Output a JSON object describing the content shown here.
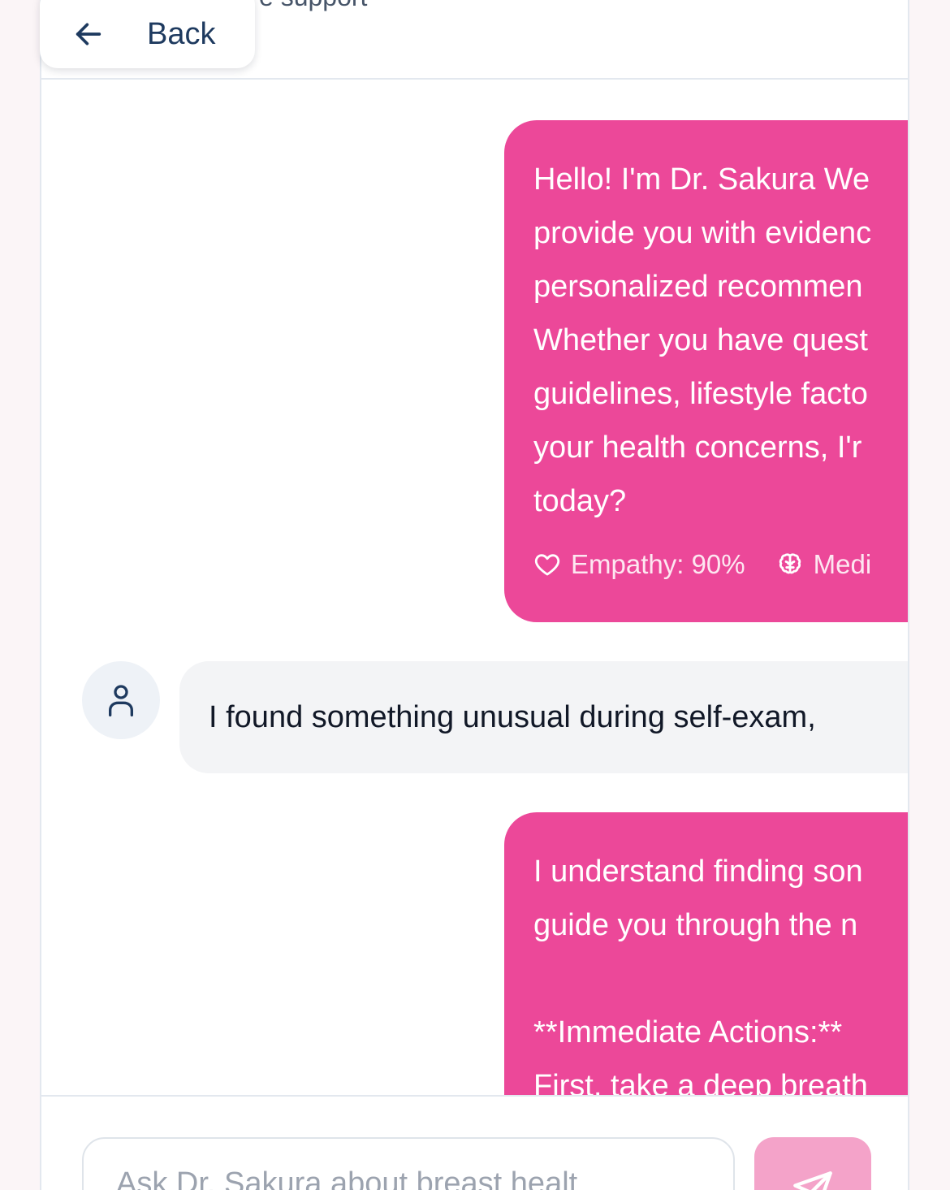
{
  "header": {
    "back_label": "Back",
    "subtitle": "e support"
  },
  "messages": [
    {
      "role": "assistant",
      "lines": [
        "Hello! I'm Dr. Sakura We",
        "provide you with evidenc",
        "personalized recommen",
        "Whether you have quest",
        "guidelines, lifestyle facto",
        "your health concerns, I'r",
        "today?"
      ],
      "metrics": [
        {
          "icon": "heart-icon",
          "label": "Empathy: 90%"
        },
        {
          "icon": "brain-icon",
          "label": "Medi"
        }
      ]
    },
    {
      "role": "user",
      "text": "I found something unusual during self-exam,"
    },
    {
      "role": "assistant",
      "lines": [
        "I understand finding son",
        "guide you through the n",
        "",
        "**Immediate Actions:**",
        "First, take a deep breath"
      ]
    }
  ],
  "composer": {
    "placeholder": "Ask Dr. Sakura about breast healt"
  },
  "colors": {
    "accent": "#ec4899",
    "send_button": "#f4a3c9",
    "user_bubble": "#f3f4f6"
  }
}
